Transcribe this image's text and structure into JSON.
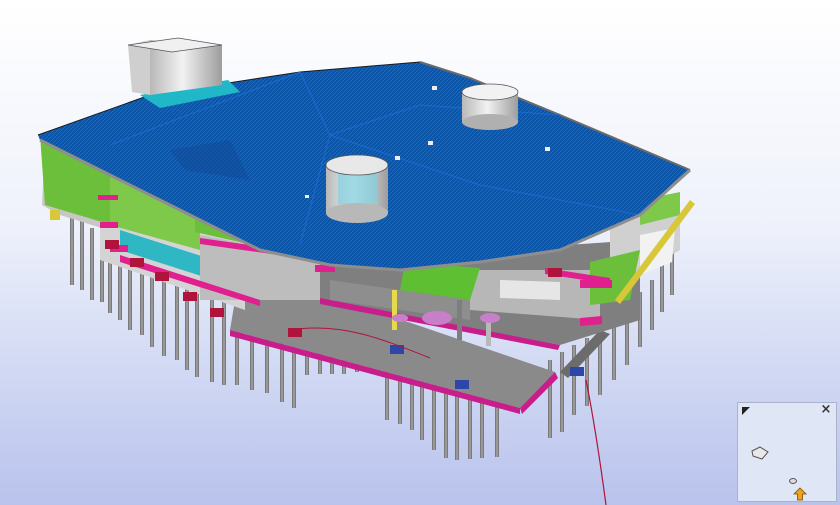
{
  "viewer": {
    "background_top": "#ffffff",
    "background_bottom": "#b9c3ec"
  },
  "model": {
    "roof_color": "#0b55a8",
    "roof_edge_color": "#1c6ad0",
    "slab_color": "#8d8d8d",
    "column_color": "#7e7e7e",
    "beam_color": "#e0208e",
    "wall_color": "#d8d8d8",
    "facade_color": "#6fc33b",
    "glazing_color": "#20b7c9",
    "footing_color": "#b0143c"
  },
  "navigator": {
    "corner_icon": "corner-arrow-icon",
    "close_icon": "close-icon",
    "close_glyph": "×",
    "camera_icon": "camera-icon",
    "target_icon": "target-icon",
    "position_icon": "position-arrow-icon",
    "arrow_color": "#f2a313"
  }
}
